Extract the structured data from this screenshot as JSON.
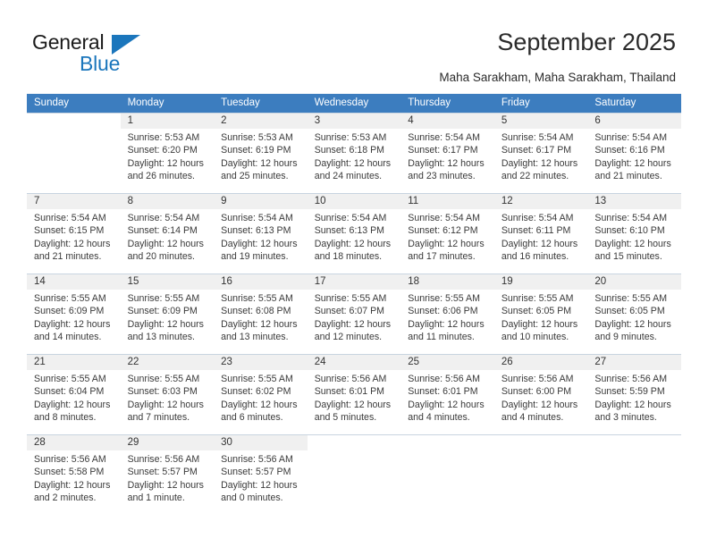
{
  "brand": {
    "word_one": "General",
    "word_two": "Blue",
    "triangle_icon": "triangle-icon",
    "accent_color": "#1b76bc"
  },
  "header": {
    "title": "September 2025",
    "subtitle": "Maha Sarakham, Maha Sarakham, Thailand"
  },
  "calendar": {
    "header_color": "#3c7dbf",
    "weekday_headers": [
      "Sunday",
      "Monday",
      "Tuesday",
      "Wednesday",
      "Thursday",
      "Friday",
      "Saturday"
    ],
    "weeks": [
      [
        {
          "day": "",
          "lines": []
        },
        {
          "day": "1",
          "lines": [
            "Sunrise: 5:53 AM",
            "Sunset: 6:20 PM",
            "Daylight: 12 hours",
            "and 26 minutes."
          ]
        },
        {
          "day": "2",
          "lines": [
            "Sunrise: 5:53 AM",
            "Sunset: 6:19 PM",
            "Daylight: 12 hours",
            "and 25 minutes."
          ]
        },
        {
          "day": "3",
          "lines": [
            "Sunrise: 5:53 AM",
            "Sunset: 6:18 PM",
            "Daylight: 12 hours",
            "and 24 minutes."
          ]
        },
        {
          "day": "4",
          "lines": [
            "Sunrise: 5:54 AM",
            "Sunset: 6:17 PM",
            "Daylight: 12 hours",
            "and 23 minutes."
          ]
        },
        {
          "day": "5",
          "lines": [
            "Sunrise: 5:54 AM",
            "Sunset: 6:17 PM",
            "Daylight: 12 hours",
            "and 22 minutes."
          ]
        },
        {
          "day": "6",
          "lines": [
            "Sunrise: 5:54 AM",
            "Sunset: 6:16 PM",
            "Daylight: 12 hours",
            "and 21 minutes."
          ]
        }
      ],
      [
        {
          "day": "7",
          "lines": [
            "Sunrise: 5:54 AM",
            "Sunset: 6:15 PM",
            "Daylight: 12 hours",
            "and 21 minutes."
          ]
        },
        {
          "day": "8",
          "lines": [
            "Sunrise: 5:54 AM",
            "Sunset: 6:14 PM",
            "Daylight: 12 hours",
            "and 20 minutes."
          ]
        },
        {
          "day": "9",
          "lines": [
            "Sunrise: 5:54 AM",
            "Sunset: 6:13 PM",
            "Daylight: 12 hours",
            "and 19 minutes."
          ]
        },
        {
          "day": "10",
          "lines": [
            "Sunrise: 5:54 AM",
            "Sunset: 6:13 PM",
            "Daylight: 12 hours",
            "and 18 minutes."
          ]
        },
        {
          "day": "11",
          "lines": [
            "Sunrise: 5:54 AM",
            "Sunset: 6:12 PM",
            "Daylight: 12 hours",
            "and 17 minutes."
          ]
        },
        {
          "day": "12",
          "lines": [
            "Sunrise: 5:54 AM",
            "Sunset: 6:11 PM",
            "Daylight: 12 hours",
            "and 16 minutes."
          ]
        },
        {
          "day": "13",
          "lines": [
            "Sunrise: 5:54 AM",
            "Sunset: 6:10 PM",
            "Daylight: 12 hours",
            "and 15 minutes."
          ]
        }
      ],
      [
        {
          "day": "14",
          "lines": [
            "Sunrise: 5:55 AM",
            "Sunset: 6:09 PM",
            "Daylight: 12 hours",
            "and 14 minutes."
          ]
        },
        {
          "day": "15",
          "lines": [
            "Sunrise: 5:55 AM",
            "Sunset: 6:09 PM",
            "Daylight: 12 hours",
            "and 13 minutes."
          ]
        },
        {
          "day": "16",
          "lines": [
            "Sunrise: 5:55 AM",
            "Sunset: 6:08 PM",
            "Daylight: 12 hours",
            "and 13 minutes."
          ]
        },
        {
          "day": "17",
          "lines": [
            "Sunrise: 5:55 AM",
            "Sunset: 6:07 PM",
            "Daylight: 12 hours",
            "and 12 minutes."
          ]
        },
        {
          "day": "18",
          "lines": [
            "Sunrise: 5:55 AM",
            "Sunset: 6:06 PM",
            "Daylight: 12 hours",
            "and 11 minutes."
          ]
        },
        {
          "day": "19",
          "lines": [
            "Sunrise: 5:55 AM",
            "Sunset: 6:05 PM",
            "Daylight: 12 hours",
            "and 10 minutes."
          ]
        },
        {
          "day": "20",
          "lines": [
            "Sunrise: 5:55 AM",
            "Sunset: 6:05 PM",
            "Daylight: 12 hours",
            "and 9 minutes."
          ]
        }
      ],
      [
        {
          "day": "21",
          "lines": [
            "Sunrise: 5:55 AM",
            "Sunset: 6:04 PM",
            "Daylight: 12 hours",
            "and 8 minutes."
          ]
        },
        {
          "day": "22",
          "lines": [
            "Sunrise: 5:55 AM",
            "Sunset: 6:03 PM",
            "Daylight: 12 hours",
            "and 7 minutes."
          ]
        },
        {
          "day": "23",
          "lines": [
            "Sunrise: 5:55 AM",
            "Sunset: 6:02 PM",
            "Daylight: 12 hours",
            "and 6 minutes."
          ]
        },
        {
          "day": "24",
          "lines": [
            "Sunrise: 5:56 AM",
            "Sunset: 6:01 PM",
            "Daylight: 12 hours",
            "and 5 minutes."
          ]
        },
        {
          "day": "25",
          "lines": [
            "Sunrise: 5:56 AM",
            "Sunset: 6:01 PM",
            "Daylight: 12 hours",
            "and 4 minutes."
          ]
        },
        {
          "day": "26",
          "lines": [
            "Sunrise: 5:56 AM",
            "Sunset: 6:00 PM",
            "Daylight: 12 hours",
            "and 4 minutes."
          ]
        },
        {
          "day": "27",
          "lines": [
            "Sunrise: 5:56 AM",
            "Sunset: 5:59 PM",
            "Daylight: 12 hours",
            "and 3 minutes."
          ]
        }
      ],
      [
        {
          "day": "28",
          "lines": [
            "Sunrise: 5:56 AM",
            "Sunset: 5:58 PM",
            "Daylight: 12 hours",
            "and 2 minutes."
          ]
        },
        {
          "day": "29",
          "lines": [
            "Sunrise: 5:56 AM",
            "Sunset: 5:57 PM",
            "Daylight: 12 hours",
            "and 1 minute."
          ]
        },
        {
          "day": "30",
          "lines": [
            "Sunrise: 5:56 AM",
            "Sunset: 5:57 PM",
            "Daylight: 12 hours",
            "and 0 minutes."
          ]
        },
        {
          "day": "",
          "lines": []
        },
        {
          "day": "",
          "lines": []
        },
        {
          "day": "",
          "lines": []
        },
        {
          "day": "",
          "lines": []
        }
      ]
    ]
  }
}
